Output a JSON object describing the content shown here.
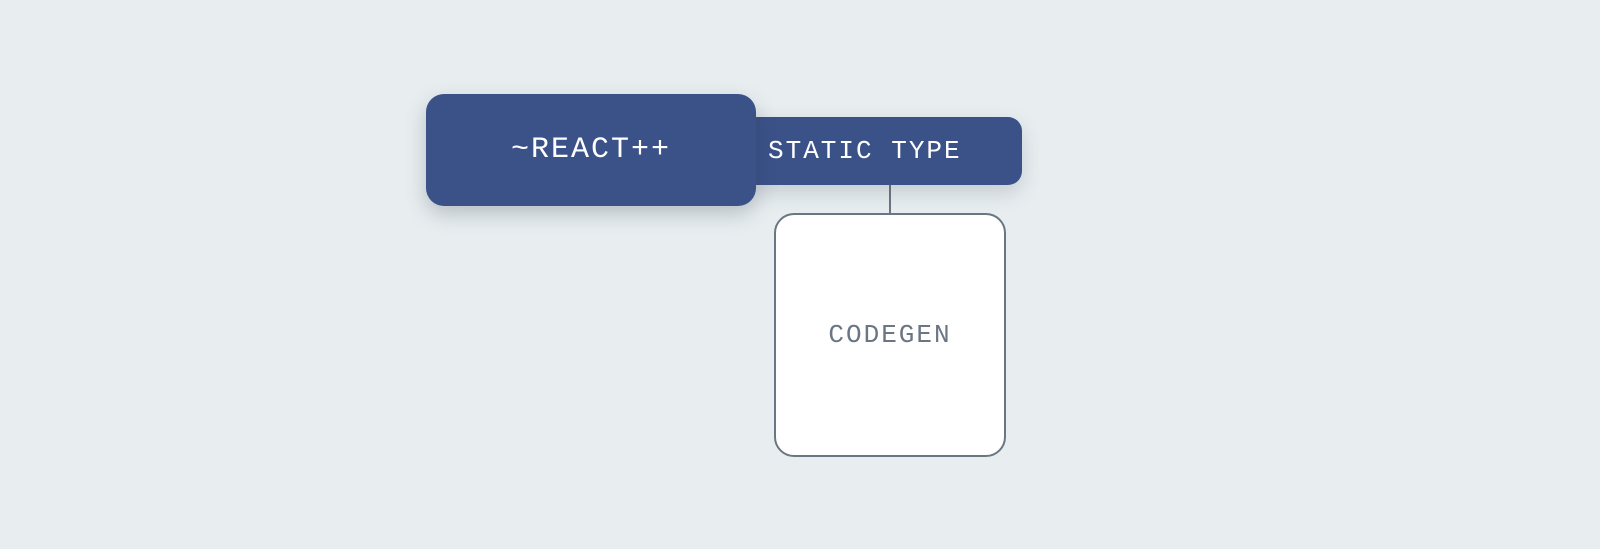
{
  "nodes": {
    "react": {
      "label": "~REACT++"
    },
    "static": {
      "label": "STATIC TYPE"
    },
    "codegen": {
      "label": "CODEGEN"
    }
  },
  "colors": {
    "background": "#e8eef0",
    "primary_fill": "#3b5289",
    "primary_text": "#ffffff",
    "outline": "#6b7684",
    "box_fill": "#ffffff",
    "box_text": "#6b7684"
  }
}
